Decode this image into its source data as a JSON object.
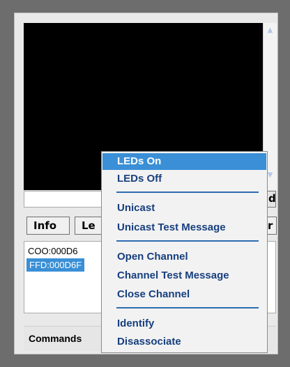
{
  "tabs": [
    {
      "label": "Info"
    },
    {
      "label": "Le"
    },
    {
      "label": "r"
    }
  ],
  "side_button_label": "d",
  "devices": [
    {
      "label": "COO:000D6",
      "selected": false
    },
    {
      "label": "FFD:000D6F",
      "selected": true
    }
  ],
  "command_bar": {
    "label": "Commands"
  },
  "context_menu": {
    "items": [
      {
        "label": "LEDs On",
        "highlighted": true
      },
      {
        "label": "LEDs Off"
      },
      {
        "label": "Unicast"
      },
      {
        "label": "Unicast Test Message"
      },
      {
        "label": "Open Channel"
      },
      {
        "label": "Channel Test Message"
      },
      {
        "label": "Close Channel"
      },
      {
        "label": "Identify"
      },
      {
        "label": "Disassociate"
      }
    ]
  },
  "colors": {
    "menu_highlight": "#3a8fd6",
    "menu_text": "#173f7e",
    "separator": "#2e6bb0",
    "console_bg": "#000000"
  }
}
